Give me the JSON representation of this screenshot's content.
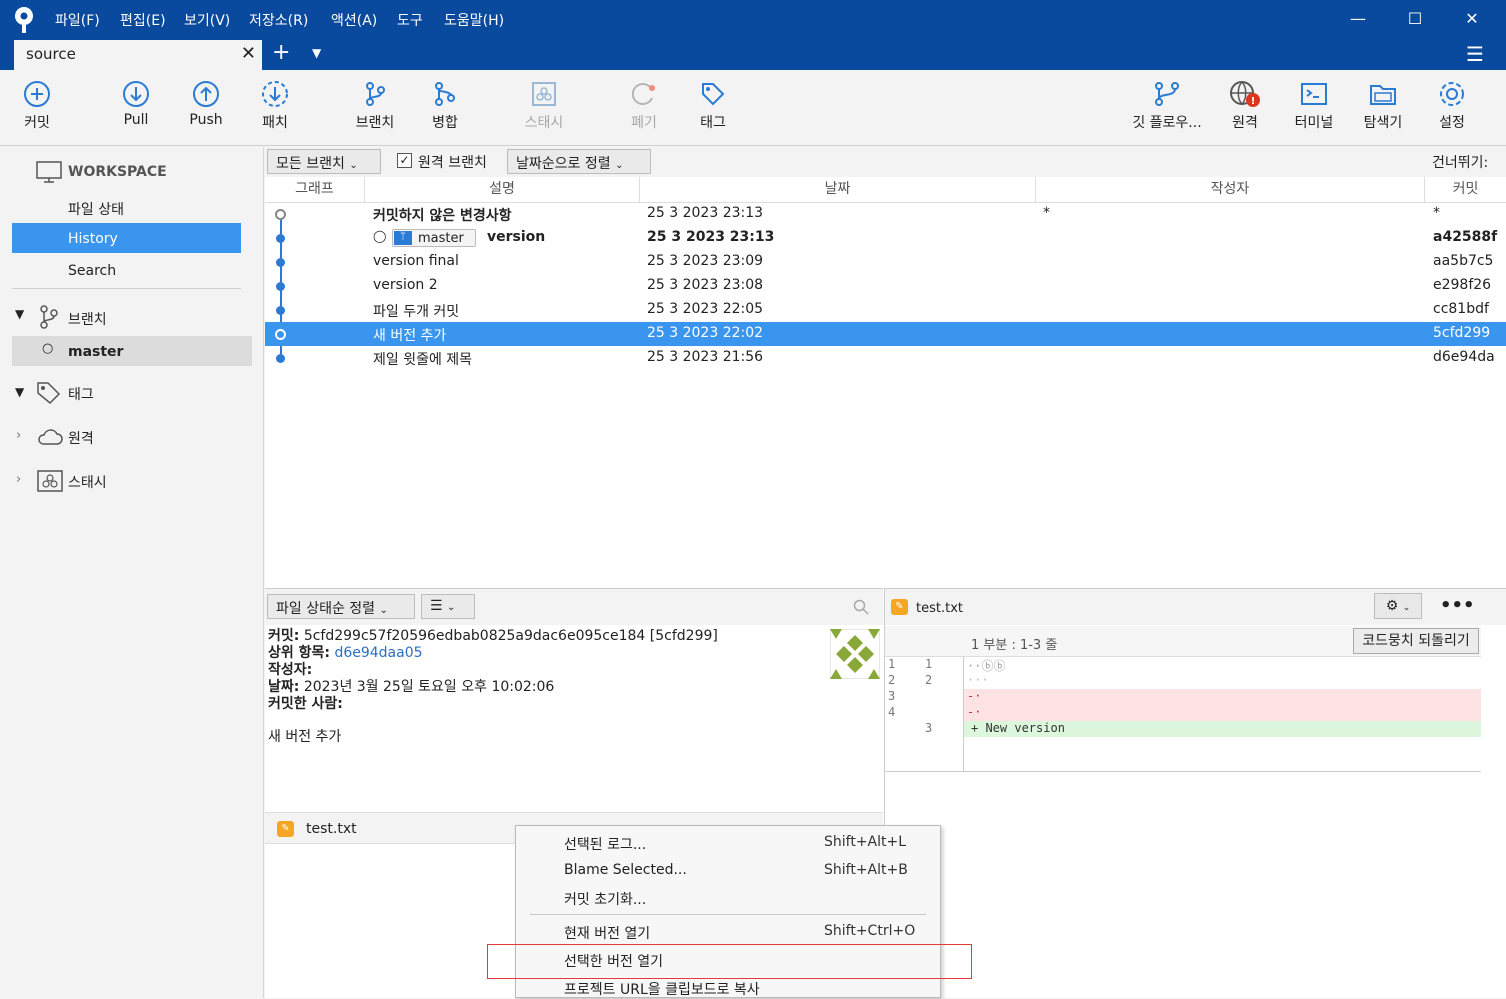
{
  "menu": [
    "파일(F)",
    "편집(E)",
    "보기(V)",
    "저장소(R)",
    "액션(A)",
    "도구",
    "도움말(H)"
  ],
  "tab": {
    "label": "source"
  },
  "toolbar": {
    "commit": "커밋",
    "pull": "Pull",
    "push": "Push",
    "fetch": "패치",
    "branch": "브랜치",
    "merge": "병합",
    "stash": "스태시",
    "discard": "폐기",
    "tag": "태그",
    "gitflow": "깃 플로우...",
    "remote": "원격",
    "terminal": "터미널",
    "explorer": "탐색기",
    "settings": "설정"
  },
  "sidebar": {
    "workspace": "WORKSPACE",
    "file_status": "파일 상태",
    "history": "History",
    "search": "Search",
    "branches": "브랜치",
    "master": "master",
    "tags": "태그",
    "remotes": "원격",
    "stashes": "스태시"
  },
  "filter": {
    "all_branches": "모든 브랜치",
    "remote_branches": "원격 브랜치",
    "sort": "날짜순으로 정렬",
    "skip": "건너뛰기:"
  },
  "columns": {
    "graph": "그래프",
    "desc": "설명",
    "date": "날짜",
    "author": "작성자",
    "commit": "커밋"
  },
  "commits": [
    {
      "desc": "커밋하지 않은 변경사항",
      "date": "25 3 2023 23:13",
      "author": "*",
      "hash": "*"
    },
    {
      "desc": "version",
      "date": "25 3 2023 23:13",
      "author": "",
      "hash": "a42588f",
      "branch": "master"
    },
    {
      "desc": "version final",
      "date": "25 3 2023 23:09",
      "author": "",
      "hash": "aa5b7c5"
    },
    {
      "desc": "version 2",
      "date": "25 3 2023 23:08",
      "author": "",
      "hash": "e298f26"
    },
    {
      "desc": "파일 두개 커밋",
      "date": "25 3 2023 22:05",
      "author": "",
      "hash": "cc81bdf"
    },
    {
      "desc": "새 버전 추가",
      "date": "25 3 2023 22:02",
      "author": "",
      "hash": "5cfd299"
    },
    {
      "desc": "제일 윗줄에 제목",
      "date": "25 3 2023 21:56",
      "author": "",
      "hash": "d6e94da"
    }
  ],
  "details": {
    "sort": "파일 상태순 정렬",
    "commit_label": "커밋:",
    "commit_value": "5cfd299c57f20596edbab0825a9dac6e095ce184 [5cfd299]",
    "parent_label": "상위 항목:",
    "parent_value": "d6e94daa05",
    "author_label": "작성자:",
    "date_label": "날짜:",
    "date_value": "2023년 3월 25일 토요일 오후 10:02:06",
    "committer_label": "커밋한 사람:",
    "message": "새 버전 추가",
    "file": "test.txt"
  },
  "diff": {
    "file": "test.txt",
    "hunk": "1 부분 : 1-3 줄",
    "revert": "코드뭉치 되돌리기",
    "lines": [
      {
        "old": "1",
        "new": "1",
        "text": "··ⓑⓑ",
        "type": "ctx"
      },
      {
        "old": "2",
        "new": "2",
        "text": "···",
        "type": "ctx"
      },
      {
        "old": "3",
        "new": "",
        "text": "-·",
        "type": "del"
      },
      {
        "old": "4",
        "new": "",
        "text": "-·",
        "type": "del"
      },
      {
        "old": "",
        "new": "3",
        "text": "+ New version",
        "type": "add"
      }
    ]
  },
  "context_menu": [
    {
      "label": "선택된 로그...",
      "shortcut": "Shift+Alt+L"
    },
    {
      "label": "Blame Selected...",
      "shortcut": "Shift+Alt+B"
    },
    {
      "label": "커밋 초기화...",
      "shortcut": ""
    },
    {
      "label": "현재 버전 열기",
      "shortcut": "Shift+Ctrl+O"
    },
    {
      "label": "선택한 버전 열기",
      "shortcut": ""
    },
    {
      "label": "프로젝트 URL을 클립보드로 복사",
      "shortcut": ""
    }
  ],
  "colors": {
    "titlebar": "#0a4a9e",
    "accent": "#3a95ef",
    "selection": "#c5dcf5",
    "highlight_box": "#e53935"
  }
}
